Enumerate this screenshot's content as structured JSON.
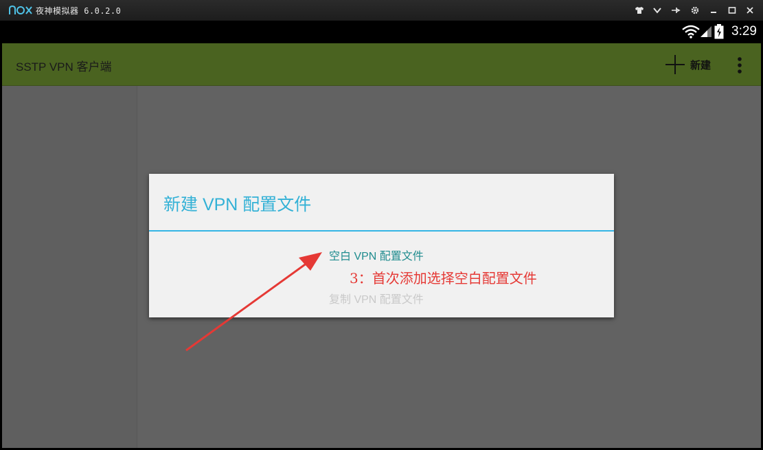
{
  "emulator": {
    "title": "夜神模拟器 6.0.2.0",
    "logo_text": "nox",
    "controls": [
      "shirt-icon",
      "chevron-down-icon",
      "pin-icon",
      "settings-icon",
      "minimize-icon",
      "maximize-icon",
      "close-icon"
    ]
  },
  "status_bar": {
    "time": "3:29"
  },
  "action_bar": {
    "title": "SSTP VPN 客户端",
    "new_label": "新建"
  },
  "dialog": {
    "title": "新建 VPN 配置文件",
    "options": [
      {
        "label": "空白 VPN 配置文件",
        "enabled": true
      },
      {
        "label": "复制 VPN 配置文件",
        "enabled": false
      }
    ]
  },
  "annotation": {
    "text": "3：首次添加选择空白配置文件",
    "color": "#e53935"
  },
  "colors": {
    "accent": "#33b5e5",
    "action_bar": "#4a6320",
    "annotation": "#e53935"
  }
}
